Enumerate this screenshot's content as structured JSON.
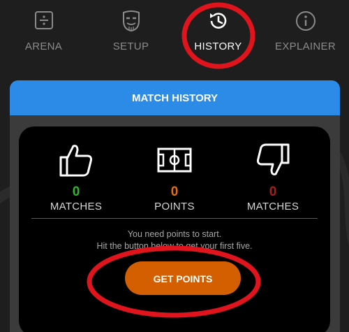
{
  "nav": {
    "tabs": [
      {
        "label": "ARENA",
        "icon": "arena-icon",
        "active": false
      },
      {
        "label": "SETUP",
        "icon": "mask-icon",
        "active": false
      },
      {
        "label": "HISTORY",
        "icon": "history-icon",
        "active": true
      },
      {
        "label": "EXPLAINER",
        "icon": "info-icon",
        "active": false
      }
    ]
  },
  "card": {
    "title": "MATCH HISTORY",
    "stats": [
      {
        "icon": "thumbs-up-icon",
        "value": "0",
        "caption": "MATCHES",
        "color": "#2fb62f"
      },
      {
        "icon": "field-icon",
        "value": "0",
        "caption": "POINTS",
        "color": "#e36f12"
      },
      {
        "icon": "thumbs-down-icon",
        "value": "0",
        "caption": "MATCHES",
        "color": "#a81d1d"
      }
    ],
    "message_line1": "You need points to start.",
    "message_line2": "Hit the button below to get your first five.",
    "button_label": "GET POINTS"
  },
  "colors": {
    "accent": "#2d8be8",
    "button": "#d35f00",
    "highlight_ring": "#e0141c",
    "background": "#1e1e1e"
  }
}
